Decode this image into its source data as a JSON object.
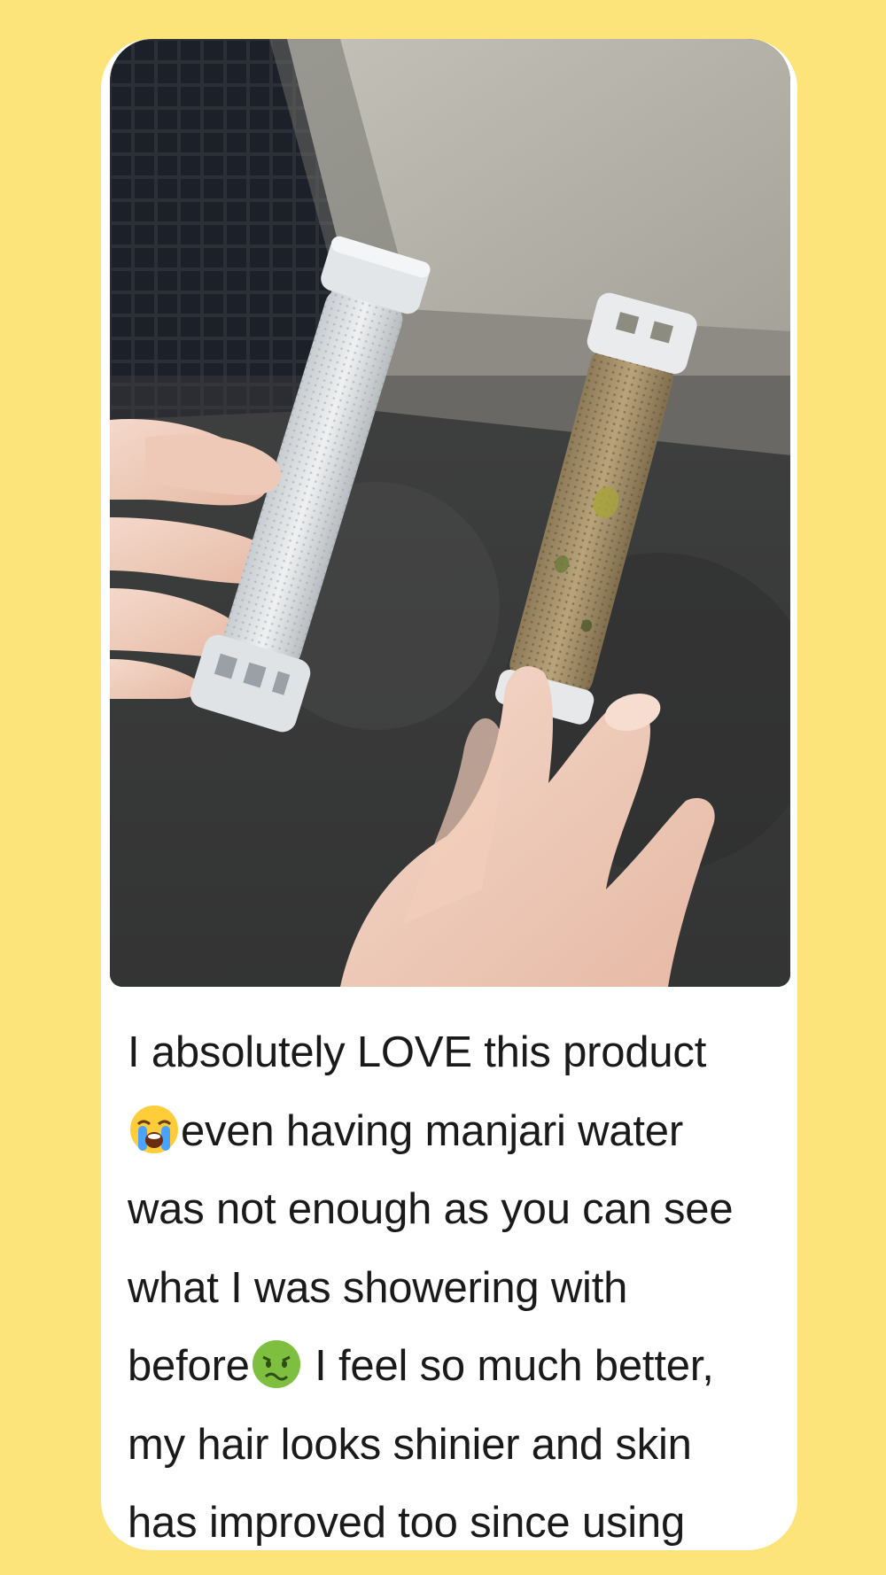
{
  "review": {
    "image_description_icon": "photo-of-clean-and-dirty-shower-filters-icon",
    "lines": [
      {
        "text": "I absolutely LOVE this product"
      },
      {
        "emoji_before": "loudly-crying-face-icon",
        "text": "even having manjari water"
      },
      {
        "text": "was not enough as you can see"
      },
      {
        "text": "what I was showering with"
      },
      {
        "text_before": "before",
        "emoji_after": "nauseated-face-icon",
        "text": " I feel so much better,"
      },
      {
        "text": "my hair looks shinier and skin"
      },
      {
        "text": "has improved too since using"
      }
    ]
  },
  "colors": {
    "background": "#fde47a",
    "card": "#ffffff",
    "text": "#1a1a1a"
  }
}
